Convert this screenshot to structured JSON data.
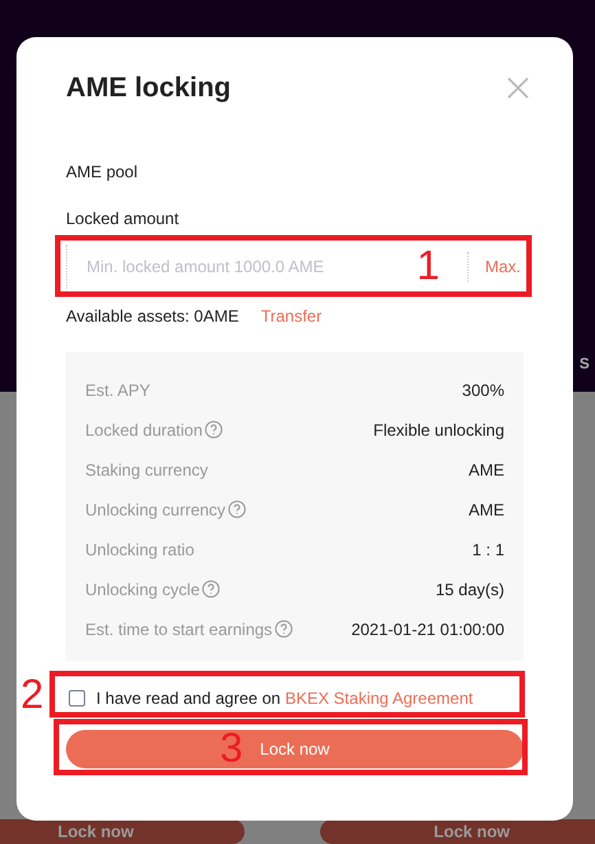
{
  "background": {
    "fragments": [
      "S"
    ],
    "buttons": [
      "Lock now",
      "Lock now"
    ]
  },
  "modal": {
    "title": "AME locking",
    "pool": "AME pool",
    "amount_label": "Locked amount",
    "input": {
      "placeholder": "Min. locked amount 1000.0 AME",
      "max": "Max."
    },
    "available": "Available assets: 0AME",
    "transfer": "Transfer",
    "details": [
      {
        "label": "Est. APY",
        "help": false,
        "value": "300%"
      },
      {
        "label": "Locked duration",
        "help": true,
        "value": "Flexible unlocking"
      },
      {
        "label": "Staking currency",
        "help": false,
        "value": "AME"
      },
      {
        "label": "Unlocking currency",
        "help": true,
        "value": "AME"
      },
      {
        "label": "Unlocking ratio",
        "help": false,
        "value": "1 : 1"
      },
      {
        "label": "Unlocking cycle",
        "help": true,
        "value": "15 day(s)"
      },
      {
        "label": "Est. time to start earnings",
        "help": true,
        "value": "2021-01-21 01:00:00"
      }
    ],
    "agreement": {
      "checked": false,
      "text": "I have read and agree on",
      "link": "BKEX Staking Agreement"
    },
    "button": "Lock now"
  },
  "annotations": [
    "1",
    "2",
    "3"
  ]
}
